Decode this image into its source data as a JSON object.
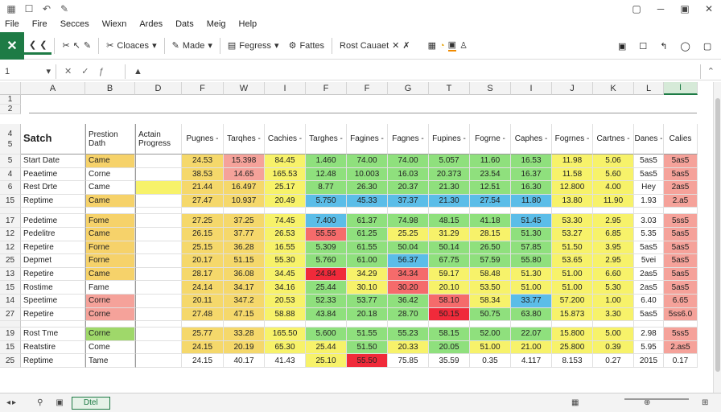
{
  "titlebar": {
    "left_icons": [
      "grid-icon",
      "square-icon",
      "undo-icon",
      "pen-icon"
    ],
    "right_icons": [
      "square-icon",
      "minimize-icon",
      "lock-icon",
      "close-icon"
    ]
  },
  "menu": [
    "File",
    "Fire",
    "Secces",
    "Wiexn",
    "Ardes",
    "Dats",
    "Meig",
    "Help"
  ],
  "ribbon": {
    "items": [
      {
        "label": "",
        "icon": "back-icon"
      },
      {
        "label": "",
        "icon": "forward-icon"
      },
      {
        "label": "",
        "icon": "scissors-icon"
      },
      {
        "label": "",
        "icon": "arrow-icon"
      },
      {
        "label": "",
        "icon": "pen-icon"
      },
      {
        "label": "Cloaces",
        "icon": "scissors-icon",
        "dropdown": true
      },
      {
        "label": "Made",
        "icon": "pen-icon",
        "dropdown": true
      },
      {
        "label": "Fegress",
        "icon": "format-icon",
        "dropdown": true
      },
      {
        "label": "Fattes",
        "icon": "gear-icon",
        "dropdown": false
      },
      {
        "label": "Rost Cauaet",
        "icon": "",
        "dropdown": false
      }
    ]
  },
  "namebox": "1",
  "columns": [
    {
      "l": "A",
      "w": 80
    },
    {
      "l": "B",
      "w": 62
    },
    {
      "l": "D",
      "w": 58
    },
    {
      "l": "F",
      "w": 52
    },
    {
      "l": "W",
      "w": 51
    },
    {
      "l": "I",
      "w": 51
    },
    {
      "l": "F",
      "w": 51
    },
    {
      "l": "F",
      "w": 51
    },
    {
      "l": "G",
      "w": 51
    },
    {
      "l": "T",
      "w": 51
    },
    {
      "l": "S",
      "w": 51
    },
    {
      "l": "I",
      "w": 51
    },
    {
      "l": "J",
      "w": 51
    },
    {
      "l": "K",
      "w": 51
    },
    {
      "l": "L",
      "w": 37
    },
    {
      "l": "I",
      "w": 42
    }
  ],
  "header_row": {
    "num": "4\n5",
    "cells": [
      "Satch",
      "Prestion\nDath",
      "Actain\nProgress",
      "Pugnes -",
      "Tarqhes -",
      "Cachies -",
      "Targhes -",
      "Fagines -",
      "Fagnes -",
      "Fupines -",
      "Fogrne -",
      "Caphes -",
      "Fogrnes -",
      "Cartnes -",
      "Danes -",
      "Calies"
    ]
  },
  "rows": [
    {
      "num": "5",
      "cells": [
        "Start Date",
        "Came",
        "",
        "24.53",
        "15.398",
        "84.45",
        "1.460",
        "74.00",
        "74.00",
        "5.057",
        "11.60",
        "16.53",
        "11.98",
        "5.06",
        "5as5",
        "5as5"
      ],
      "colors": [
        "",
        "#f6d26a",
        "",
        "#f5d86b",
        "#f5a29a",
        "#f7f26a",
        "#8fe07d",
        "#8fe07d",
        "#8fe07d",
        "#8fe07d",
        "#8fe07d",
        "#8fe07d",
        "#f7f26a",
        "#f7f26a",
        "",
        "#f5a29a"
      ]
    },
    {
      "num": "4",
      "cells": [
        "Peaetime",
        "Corne",
        "",
        "38.53",
        "14.65",
        "165.53",
        "12.48",
        "10.003",
        "16.03",
        "20.373",
        "23.54",
        "16.37",
        "11.58",
        "5.60",
        "5as5",
        "5as5"
      ],
      "colors": [
        "",
        "",
        "",
        "#f5d86b",
        "#f5a29a",
        "#f7f26a",
        "#8fe07d",
        "#8fe07d",
        "#8fe07d",
        "#8fe07d",
        "#8fe07d",
        "#8fe07d",
        "#f7f26a",
        "#f7f26a",
        "",
        "#f5a29a"
      ]
    },
    {
      "num": "6",
      "cells": [
        "Rest Drte",
        "Came",
        "",
        "21.44",
        "16.497",
        "25.17",
        "8.77",
        "26.30",
        "20.37",
        "21.30",
        "12.51",
        "16.30",
        "12.800",
        "4.00",
        "Hey",
        "2as5"
      ],
      "colors": [
        "",
        "",
        "#f7f26a",
        "#f5d86b",
        "#f5d86b",
        "#f7f26a",
        "#8fe07d",
        "#8fe07d",
        "#8fe07d",
        "#8fe07d",
        "#8fe07d",
        "#8fe07d",
        "#f7f26a",
        "#f7f26a",
        "",
        "#f5a29a"
      ]
    },
    {
      "num": "15",
      "cells": [
        "Reptime",
        "Came",
        "",
        "27.47",
        "10.937",
        "20.49",
        "5.750",
        "45.33",
        "37.37",
        "21.30",
        "27.54",
        "11.80",
        "13.80",
        "11.90",
        "1.93",
        "2.a5"
      ],
      "colors": [
        "",
        "#f6d26a",
        "",
        "#f5d86b",
        "#f5d86b",
        "#f7f26a",
        "#5bbde8",
        "#5bbde8",
        "#5bbde8",
        "#5bbde8",
        "#5bbde8",
        "#5bbde8",
        "#f7f26a",
        "#f7f26a",
        "",
        "#f5a29a"
      ]
    },
    {
      "num": "",
      "cells": [
        "",
        "",
        "",
        "",
        "",
        "",
        "",
        "",
        "",
        "",
        "",
        "",
        "",
        "",
        "",
        ""
      ],
      "colors": [
        "",
        "",
        "",
        "",
        "",
        "",
        "",
        "",
        "",
        "",
        "",
        "",
        "",
        "",
        "",
        ""
      ]
    },
    {
      "num": "17",
      "cells": [
        "Pedetime",
        "Fome",
        "",
        "27.25",
        "37.25",
        "74.45",
        "7.400",
        "61.37",
        "74.98",
        "48.15",
        "41.18",
        "51.45",
        "53.30",
        "2.95",
        "3.03",
        "5ss5"
      ],
      "colors": [
        "",
        "#f6d26a",
        "",
        "#f5d86b",
        "#f5d86b",
        "#f7f26a",
        "#5bbde8",
        "#8fe07d",
        "#8fe07d",
        "#8fe07d",
        "#8fe07d",
        "#5bbde8",
        "#f7f26a",
        "#f7f26a",
        "",
        "#f5a29a"
      ]
    },
    {
      "num": "12",
      "cells": [
        "Pedelitre",
        "Came",
        "",
        "26.15",
        "37.77",
        "26.53",
        "55.55",
        "61.25",
        "25.25",
        "31.29",
        "28.15",
        "51.30",
        "53.27",
        "6.85",
        "5.35",
        "5as5"
      ],
      "colors": [
        "",
        "#f6d26a",
        "",
        "#f5d86b",
        "#f5d86b",
        "#f7f26a",
        "#f56b6b",
        "#8fe07d",
        "#f7f26a",
        "#f7f26a",
        "#f7f26a",
        "#8fe07d",
        "#f7f26a",
        "#f7f26a",
        "",
        "#f5a29a"
      ]
    },
    {
      "num": "12",
      "cells": [
        "Repetire",
        "Forne",
        "",
        "25.15",
        "36.28",
        "16.55",
        "5.309",
        "61.55",
        "50.04",
        "50.14",
        "26.50",
        "57.85",
        "51.50",
        "3.95",
        "5as5",
        "5as5"
      ],
      "colors": [
        "",
        "#f6d26a",
        "",
        "#f5d86b",
        "#f5d86b",
        "#f7f26a",
        "#8fe07d",
        "#8fe07d",
        "#8fe07d",
        "#8fe07d",
        "#8fe07d",
        "#8fe07d",
        "#f7f26a",
        "#f7f26a",
        "",
        "#f5a29a"
      ]
    },
    {
      "num": "25",
      "cells": [
        "Depmet",
        "Forne",
        "",
        "20.17",
        "51.15",
        "55.30",
        "5.760",
        "61.00",
        "56.37",
        "67.75",
        "57.59",
        "55.80",
        "53.65",
        "2.95",
        "5vei",
        "5as5"
      ],
      "colors": [
        "",
        "#f6d26a",
        "",
        "#f5d86b",
        "#f5d86b",
        "#f7f26a",
        "#8fe07d",
        "#8fe07d",
        "#5bbde8",
        "#8fe07d",
        "#8fe07d",
        "#8fe07d",
        "#f7f26a",
        "#f7f26a",
        "",
        "#f5a29a"
      ]
    },
    {
      "num": "13",
      "cells": [
        "Repetire",
        "Came",
        "",
        "28.17",
        "36.08",
        "34.45",
        "24.84",
        "34.29",
        "34.34",
        "59.17",
        "58.48",
        "51.30",
        "51.00",
        "6.60",
        "2as5",
        "5as5"
      ],
      "colors": [
        "",
        "#f6d26a",
        "",
        "#f5d86b",
        "#f5d86b",
        "#f7f26a",
        "#f02a3a",
        "#f7f26a",
        "#f56b6b",
        "#f7f26a",
        "#f7f26a",
        "#f7f26a",
        "#f7f26a",
        "#f7f26a",
        "",
        "#f5a29a"
      ]
    },
    {
      "num": "15",
      "cells": [
        "Rostime",
        "Fame",
        "",
        "24.14",
        "34.17",
        "34.16",
        "25.44",
        "30.10",
        "30.20",
        "20.10",
        "53.50",
        "51.00",
        "51.00",
        "5.30",
        "2as5",
        "5as5"
      ],
      "colors": [
        "",
        "",
        "",
        "#f5d86b",
        "#f5d86b",
        "#f7f26a",
        "#8fe07d",
        "#f7f26a",
        "#f56b6b",
        "#f7f26a",
        "#f7f26a",
        "#f7f26a",
        "#f7f26a",
        "#f7f26a",
        "",
        "#f5a29a"
      ]
    },
    {
      "num": "14",
      "cells": [
        "Speetime",
        "Corne",
        "",
        "20.11",
        "347.2",
        "20.53",
        "52.33",
        "53.77",
        "36.42",
        "58.10",
        "58.34",
        "33.77",
        "57.200",
        "1.00",
        "6.40",
        "6.65"
      ],
      "colors": [
        "",
        "#f5a29a",
        "",
        "#f5d86b",
        "#f5d86b",
        "#f7f26a",
        "#8fe07d",
        "#8fe07d",
        "#8fe07d",
        "#f56b6b",
        "#f7f26a",
        "#5bbde8",
        "#f7f26a",
        "#f7f26a",
        "",
        "#f5a29a"
      ]
    },
    {
      "num": "27",
      "cells": [
        "Repetire",
        "Corne",
        "",
        "27.48",
        "47.15",
        "58.88",
        "43.84",
        "20.18",
        "28.70",
        "50.15",
        "50.75",
        "63.80",
        "15.873",
        "3.30",
        "5as5",
        "5ss6.0"
      ],
      "colors": [
        "",
        "#f5a29a",
        "",
        "#f5d86b",
        "#f5d86b",
        "#f7f26a",
        "#8fe07d",
        "#8fe07d",
        "#8fe07d",
        "#f02a3a",
        "#8fe07d",
        "#8fe07d",
        "#f7f26a",
        "#f7f26a",
        "",
        "#f5a29a"
      ]
    },
    {
      "num": "",
      "cells": [
        "",
        "",
        "",
        "",
        "",
        "",
        "",
        "",
        "",
        "",
        "",
        "",
        "",
        "",
        "",
        ""
      ],
      "colors": [
        "",
        "",
        "",
        "",
        "",
        "",
        "",
        "",
        "",
        "",
        "",
        "",
        "",
        "",
        "",
        ""
      ]
    },
    {
      "num": "19",
      "cells": [
        "Rost Tme",
        "Corne",
        "",
        "25.77",
        "33.28",
        "165.50",
        "5.600",
        "51.55",
        "55.23",
        "58.15",
        "52.00",
        "22.07",
        "15.800",
        "5.00",
        "2.98",
        "5ss5"
      ],
      "colors": [
        "",
        "#9fd86a",
        "",
        "#f5d86b",
        "#f5d86b",
        "#f7f26a",
        "#8fe07d",
        "#8fe07d",
        "#8fe07d",
        "#8fe07d",
        "#8fe07d",
        "#8fe07d",
        "#f7f26a",
        "#f7f26a",
        "",
        "#f5a29a"
      ]
    },
    {
      "num": "15",
      "cells": [
        "Reatstire",
        "Come",
        "",
        "24.15",
        "20.19",
        "65.30",
        "25.44",
        "51.50",
        "20.33",
        "20.05",
        "51.00",
        "21.00",
        "25.800",
        "0.39",
        "5.95",
        "2.as5"
      ],
      "colors": [
        "",
        "",
        "",
        "#f5d86b",
        "#f5d86b",
        "#f7f26a",
        "#f7f26a",
        "#8fe07d",
        "#f7f26a",
        "#8fe07d",
        "#f7f26a",
        "#f7f26a",
        "#f7f26a",
        "#f7f26a",
        "",
        "#f5a29a"
      ]
    },
    {
      "num": "25",
      "cells": [
        "Reptime",
        "Tame",
        "",
        "24.15",
        "40.17",
        "41.43",
        "25.10",
        "55.50",
        "75.85",
        "35.59",
        "0.35",
        "4.117",
        "8.153",
        "0.27",
        "2015",
        "0.17"
      ],
      "colors": [
        "",
        "",
        "",
        "",
        "",
        "",
        "#f7f26a",
        "#f02a3a",
        "",
        "",
        "",
        "",
        "",
        "",
        "",
        ""
      ]
    }
  ],
  "row_nums_top": [
    "1",
    "2",
    "4\n5"
  ],
  "status": {
    "sheet": "Dtel",
    "left_icons": [
      "prev-icon",
      "next-icon",
      "link-icon",
      "page-icon"
    ]
  }
}
